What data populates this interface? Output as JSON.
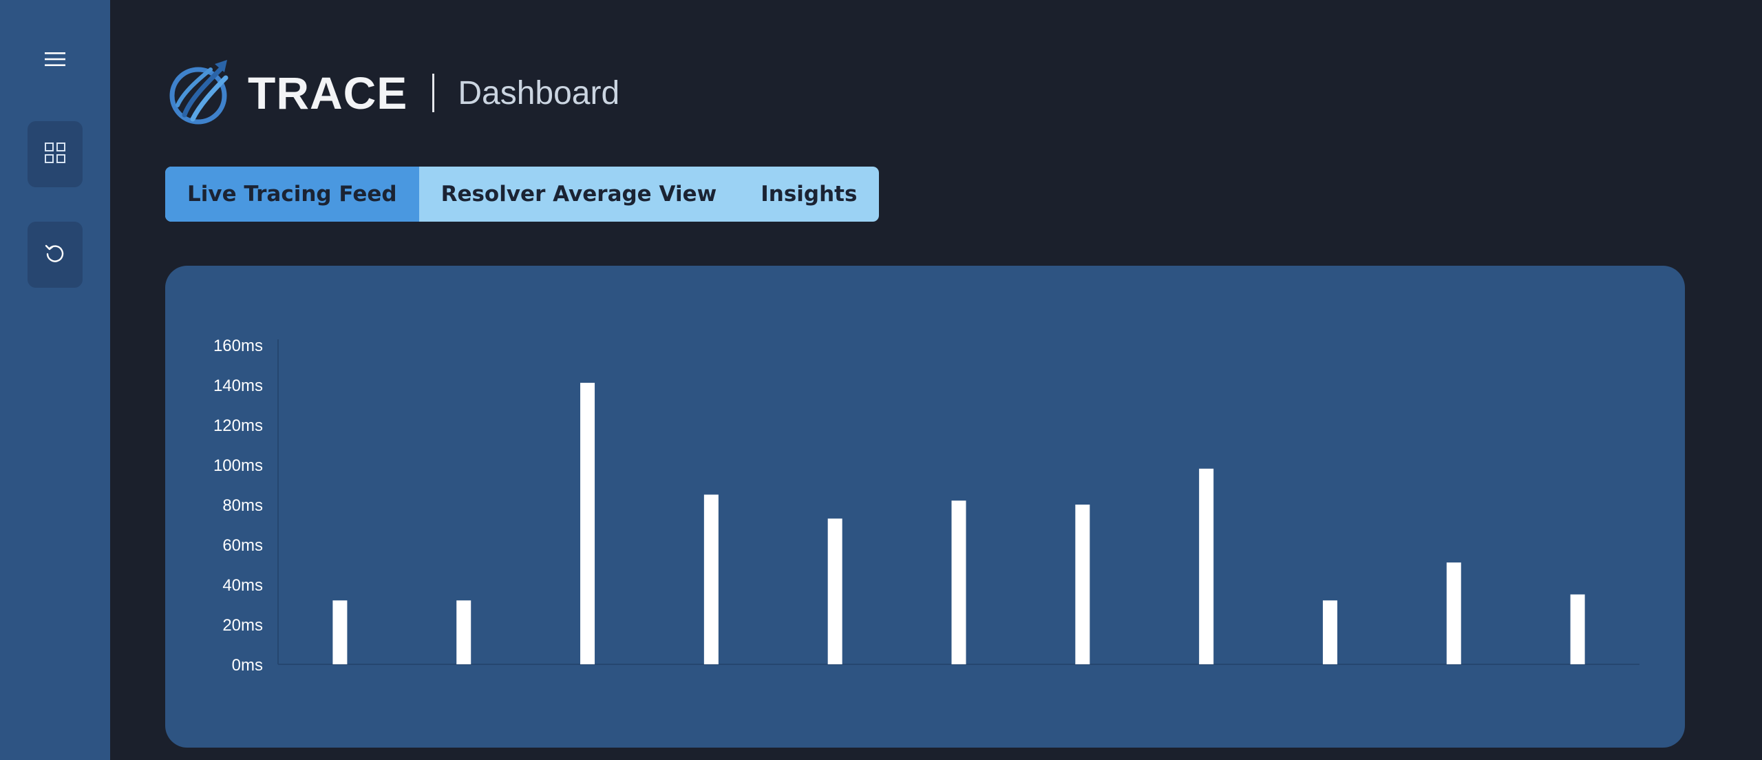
{
  "app": {
    "brand": "TRACE",
    "subtitle": "Dashboard"
  },
  "sidebar": {
    "menu_icon": "hamburger-menu-icon",
    "buttons": [
      {
        "icon": "grid-icon"
      },
      {
        "icon": "refresh-icon"
      }
    ]
  },
  "tabs": [
    {
      "label": "Live Tracing Feed",
      "active": true
    },
    {
      "label": "Resolver Average View",
      "active": false
    },
    {
      "label": "Insights",
      "active": false
    }
  ],
  "colors": {
    "sidebar": "#2e5483",
    "background": "#1b202c",
    "panel": "#2e5482",
    "tab_active": "#4a98e0",
    "tab_inactive": "#9bd2f4",
    "bar": "#ffffff"
  },
  "chart_data": {
    "type": "bar",
    "title": "",
    "xlabel": "",
    "ylabel": "",
    "ylim": [
      0,
      160
    ],
    "y_ticks": [
      "0ms",
      "20ms",
      "40ms",
      "60ms",
      "80ms",
      "100ms",
      "120ms",
      "140ms",
      "160ms"
    ],
    "grid": false,
    "categories": [
      "",
      "",
      "",
      "",
      "",
      "",
      "",
      "",
      "",
      "",
      ""
    ],
    "values": [
      32,
      32,
      141,
      85,
      73,
      82,
      80,
      98,
      32,
      51,
      35
    ]
  }
}
